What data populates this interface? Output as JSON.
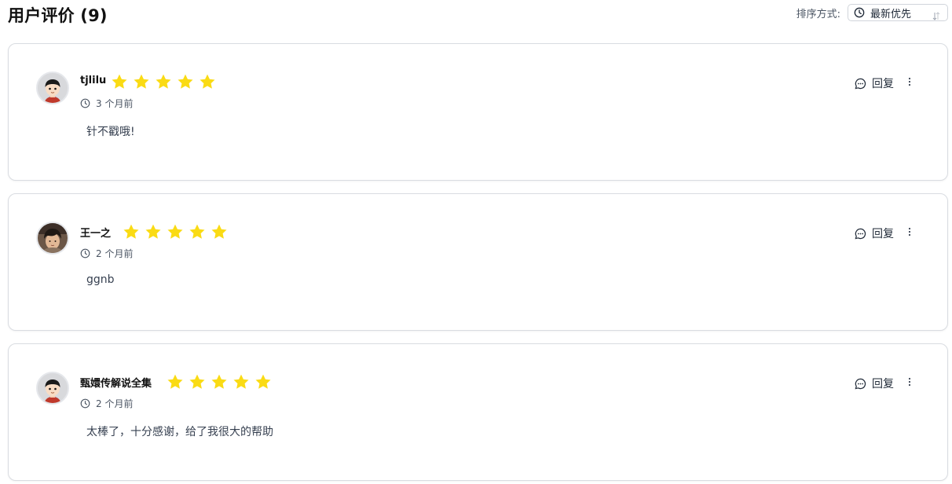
{
  "header": {
    "title": "用户评价 (9)",
    "sort_label": "排序方式:",
    "sort_value": "最新优先"
  },
  "colors": {
    "star": "#fadb14",
    "border": "#d9dce1",
    "text_muted": "#4b5563"
  },
  "reviews": [
    {
      "name": "tjlilu",
      "rating": 5,
      "time": "3 个月前",
      "content": "针不戳哦!",
      "reply_label": "回复",
      "avatar": "cartoon-avatar"
    },
    {
      "name": "王一之",
      "rating": 5,
      "time": "2 个月前",
      "content": "ggnb",
      "reply_label": "回复",
      "avatar": "photo-avatar"
    },
    {
      "name": "甄嬛传解说全集",
      "rating": 5,
      "time": "2 个月前",
      "content": "太棒了，十分感谢，给了我很大的帮助",
      "reply_label": "回复",
      "avatar": "cartoon-avatar"
    }
  ]
}
